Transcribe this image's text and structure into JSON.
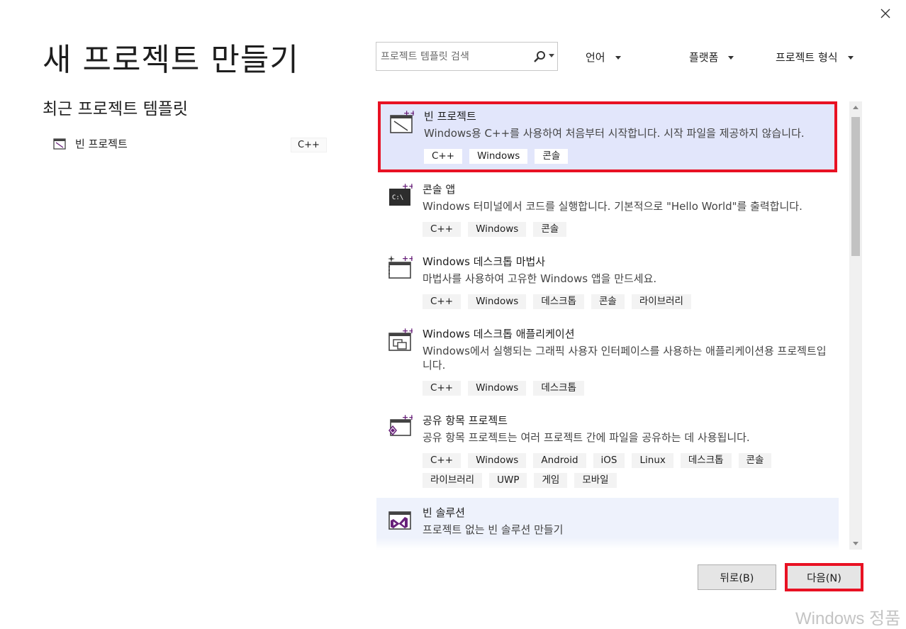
{
  "header": {
    "title": "새 프로젝트 만들기"
  },
  "recent": {
    "heading": "최근 프로젝트 템플릿",
    "items": [
      {
        "label": "빈 프로젝트",
        "tag": "C++"
      }
    ]
  },
  "search": {
    "placeholder": "프로젝트 템플릿 검색",
    "value": ""
  },
  "filters": {
    "language": "언어",
    "platform": "플랫폼",
    "project_type": "프로젝트 형식"
  },
  "templates": [
    {
      "title": "빈 프로젝트",
      "desc": "Windows용 C++를 사용하여 처음부터 시작합니다. 시작 파일을 제공하지 않습니다.",
      "tags": [
        "C++",
        "Windows",
        "콘솔"
      ],
      "selected": true
    },
    {
      "title": "콘솔 앱",
      "desc": "Windows 터미널에서 코드를 실행합니다. 기본적으로 \"Hello World\"를 출력합니다.",
      "tags": [
        "C++",
        "Windows",
        "콘솔"
      ]
    },
    {
      "title": "Windows 데스크톱 마법사",
      "desc": "마법사를 사용하여 고유한 Windows 앱을 만드세요.",
      "tags": [
        "C++",
        "Windows",
        "데스크톱",
        "콘솔",
        "라이브러리"
      ]
    },
    {
      "title": "Windows 데스크톱 애플리케이션",
      "desc": "Windows에서 실행되는 그래픽 사용자 인터페이스를 사용하는 애플리케이션용 프로젝트입니다.",
      "tags": [
        "C++",
        "Windows",
        "데스크톱"
      ]
    },
    {
      "title": "공유 항목 프로젝트",
      "desc": "공유 항목 프로젝트는 여러 프로젝트 간에 파일을 공유하는 데 사용됩니다.",
      "tags": [
        "C++",
        "Windows",
        "Android",
        "iOS",
        "Linux",
        "데스크톱",
        "콘솔",
        "라이브러리",
        "UWP",
        "게임",
        "모바일"
      ]
    },
    {
      "title": "빈 솔루션",
      "desc": "프로젝트 없는 빈 솔루션 만들기",
      "tags": []
    }
  ],
  "footer": {
    "back_label": "뒤로(B)",
    "next_label": "다음(N)"
  },
  "watermark": "Windows 정품",
  "colors": {
    "selection_bg": "#e2e6fb",
    "highlight_border": "#e81123",
    "accent_purple": "#68217a"
  }
}
